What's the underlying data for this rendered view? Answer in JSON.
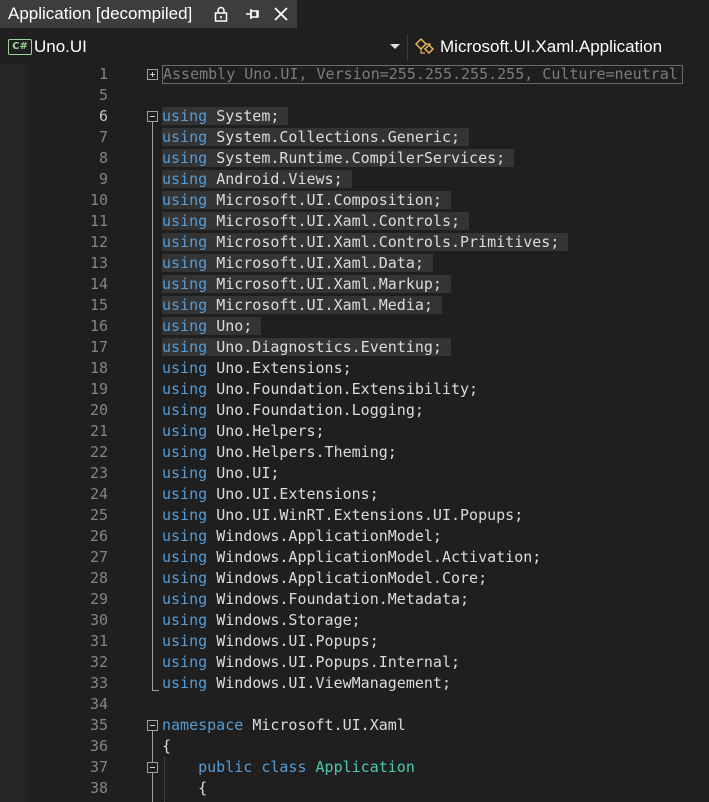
{
  "tab": {
    "title": "Application [decompiled]"
  },
  "navbar": {
    "project_icon": "C#",
    "project": "Uno.UI",
    "member": "Microsoft.UI.Xaml.Application"
  },
  "editor": {
    "collapsed_line": {
      "number": "1",
      "text": "Assembly Uno.UI, Version=255.255.255.255, Culture=neutral"
    },
    "using_keyword": "using",
    "usings": [
      {
        "number": "6",
        "ns": "System;"
      },
      {
        "number": "7",
        "ns": "System.Collections.Generic;"
      },
      {
        "number": "8",
        "ns": "System.Runtime.CompilerServices;"
      },
      {
        "number": "9",
        "ns": "Android.Views;"
      },
      {
        "number": "10",
        "ns": "Microsoft.UI.Composition;"
      },
      {
        "number": "11",
        "ns": "Microsoft.UI.Xaml.Controls;"
      },
      {
        "number": "12",
        "ns": "Microsoft.UI.Xaml.Controls.Primitives;"
      },
      {
        "number": "13",
        "ns": "Microsoft.UI.Xaml.Data;"
      },
      {
        "number": "14",
        "ns": "Microsoft.UI.Xaml.Markup;"
      },
      {
        "number": "15",
        "ns": "Microsoft.UI.Xaml.Media;"
      },
      {
        "number": "16",
        "ns": "Uno;"
      },
      {
        "number": "17",
        "ns": "Uno.Diagnostics.Eventing;"
      },
      {
        "number": "18",
        "ns": "Uno.Extensions;"
      },
      {
        "number": "19",
        "ns": "Uno.Foundation.Extensibility;"
      },
      {
        "number": "20",
        "ns": "Uno.Foundation.Logging;"
      },
      {
        "number": "21",
        "ns": "Uno.Helpers;"
      },
      {
        "number": "22",
        "ns": "Uno.Helpers.Theming;"
      },
      {
        "number": "23",
        "ns": "Uno.UI;"
      },
      {
        "number": "24",
        "ns": "Uno.UI.Extensions;"
      },
      {
        "number": "25",
        "ns": "Uno.UI.WinRT.Extensions.UI.Popups;"
      },
      {
        "number": "26",
        "ns": "Windows.ApplicationModel;"
      },
      {
        "number": "27",
        "ns": "Windows.ApplicationModel.Activation;"
      },
      {
        "number": "28",
        "ns": "Windows.ApplicationModel.Core;"
      },
      {
        "number": "29",
        "ns": "Windows.Foundation.Metadata;"
      },
      {
        "number": "30",
        "ns": "Windows.Storage;"
      },
      {
        "number": "31",
        "ns": "Windows.UI.Popups;"
      },
      {
        "number": "32",
        "ns": "Windows.UI.Popups.Internal;"
      },
      {
        "number": "33",
        "ns": "Windows.UI.ViewManagement;"
      }
    ],
    "blank_lines": [
      "5",
      "34"
    ],
    "namespace_line": {
      "number": "35",
      "keyword": "namespace",
      "name": "Microsoft.UI.Xaml"
    },
    "open_brace_line": {
      "number": "36",
      "text": "{"
    },
    "class_line": {
      "number": "37",
      "kw1": "public",
      "kw2": "class",
      "name": "Application"
    },
    "class_brace_line": {
      "number": "38",
      "text": "{"
    }
  }
}
